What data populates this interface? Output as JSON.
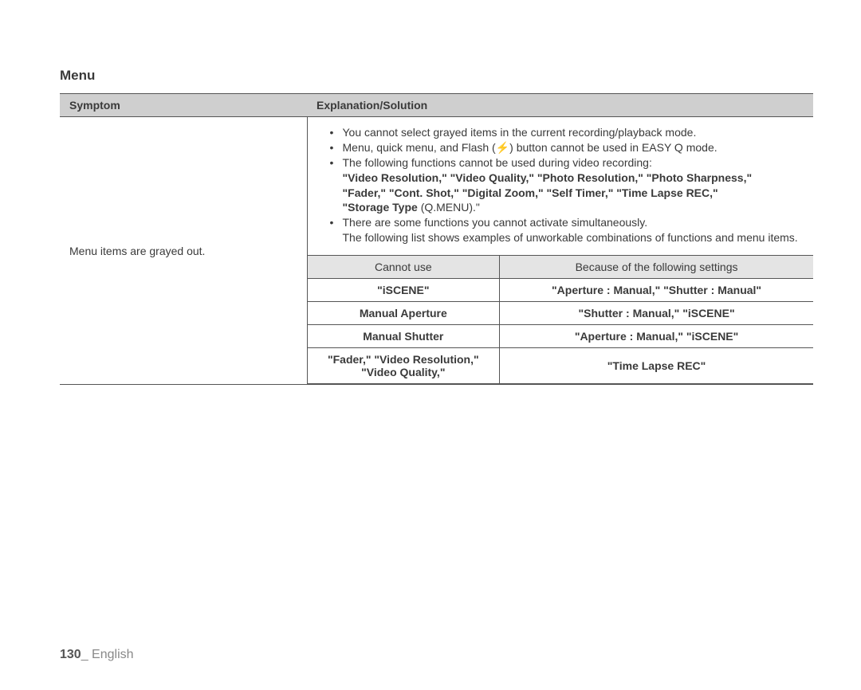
{
  "section_title": "Menu",
  "header": {
    "symptom": "Symptom",
    "explanation": "Explanation/Solution"
  },
  "symptom_text": "Menu items are grayed out.",
  "bullets": {
    "b1": "You cannot select grayed items in the current recording/playback mode.",
    "b2_pre": "Menu, quick menu, and Flash (",
    "b2_icon": "⚡",
    "b2_post": ") button cannot be used in EASY Q mode.",
    "b3": "The following functions cannot be used during video recording:",
    "b3_bold1": "\"Video Resolution,\" \"Video Quality,\" \"Photo Resolution,\" \"Photo Sharpness,\"",
    "b3_bold2": "\"Fader,\" \"Cont. Shot,\" \"Digital Zoom,\" \"Self Timer,\" \"Time Lapse REC,\"",
    "b3_bold3_a": "\"Storage Type ",
    "b3_bold3_b": "(Q.MENU).\"",
    "b4": "There are some functions you cannot activate simultaneously.",
    "b4_cont": "The following list shows examples of unworkable combinations of functions and menu items."
  },
  "inner_header": {
    "col1": "Cannot use",
    "col2": "Because of the following settings"
  },
  "inner_rows": [
    {
      "c1": "\"iSCENE\"",
      "c2": "\"Aperture : Manual,\" \"Shutter : Manual\""
    },
    {
      "c1": "Manual Aperture",
      "c2": "\"Shutter : Manual,\" \"iSCENE\""
    },
    {
      "c1": "Manual Shutter",
      "c2": "\"Aperture : Manual,\" \"iSCENE\""
    },
    {
      "c1": "\"Fader,\" \"Video Resolution,\" \"Video Quality,\"",
      "c2": "\"Time Lapse REC\""
    }
  ],
  "footer": {
    "page_number": "130",
    "sep": "_ ",
    "lang": "English"
  }
}
